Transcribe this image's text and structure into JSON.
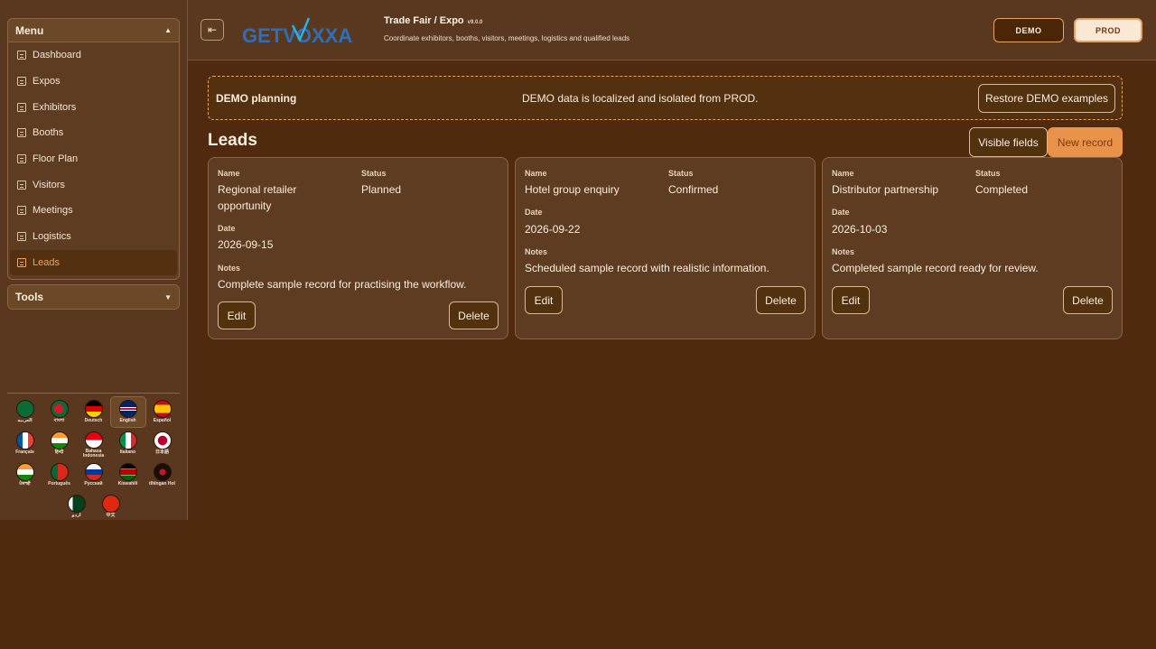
{
  "sidebar": {
    "menu_title": "Menu",
    "items": [
      {
        "label": "Dashboard"
      },
      {
        "label": "Expos"
      },
      {
        "label": "Exhibitors"
      },
      {
        "label": "Booths"
      },
      {
        "label": "Floor Plan"
      },
      {
        "label": "Visitors"
      },
      {
        "label": "Meetings"
      },
      {
        "label": "Logistics"
      },
      {
        "label": "Leads",
        "active": true
      }
    ],
    "tools_title": "Tools",
    "languages": [
      {
        "label": "العربية"
      },
      {
        "label": "বাংলা"
      },
      {
        "label": "Deutsch"
      },
      {
        "label": "English",
        "selected": true
      },
      {
        "label": "Español"
      },
      {
        "label": "Français"
      },
      {
        "label": "हिन्दी"
      },
      {
        "label": "Bahasa Indonesia"
      },
      {
        "label": "Italiano"
      },
      {
        "label": "日本語"
      },
      {
        "label": "ਪੰਜਾਬੀ"
      },
      {
        "label": "Português"
      },
      {
        "label": "Русский"
      },
      {
        "label": "Kiswahili"
      },
      {
        "label": "tlhIngan Hol"
      },
      {
        "label": "اردو"
      },
      {
        "label": "中文"
      }
    ]
  },
  "header": {
    "logo_text": "GETVOXXA",
    "title": "Trade Fair / Expo",
    "version": "v9.0.0",
    "subtitle": "Coordinate exhibitors, booths, visitors, meetings, logistics and qualified leads",
    "env_demo": "DEMO",
    "env_prod": "PROD",
    "collapse_icon": "⇤"
  },
  "banner": {
    "title": "DEMO planning",
    "message": "DEMO data is localized and isolated from PROD.",
    "restore_label": "Restore DEMO examples"
  },
  "leads": {
    "title": "Leads",
    "visible_fields_label": "Visible fields",
    "new_record_label": "New record",
    "field_labels": {
      "name": "Name",
      "status": "Status",
      "date": "Date",
      "notes": "Notes"
    },
    "edit_label": "Edit",
    "delete_label": "Delete",
    "records": [
      {
        "name": "Regional retailer opportunity",
        "status": "Planned",
        "date": "2026-09-15",
        "notes": "Complete sample record for practising the workflow."
      },
      {
        "name": "Hotel group enquiry",
        "status": "Confirmed",
        "date": "2026-09-22",
        "notes": "Scheduled sample record with realistic information."
      },
      {
        "name": "Distributor partnership",
        "status": "Completed",
        "date": "2026-10-03",
        "notes": "Completed sample record ready for review."
      }
    ]
  },
  "colors": {
    "accent": "#e8924a",
    "background": "#4f2a0f",
    "panel": "#5a3820"
  }
}
